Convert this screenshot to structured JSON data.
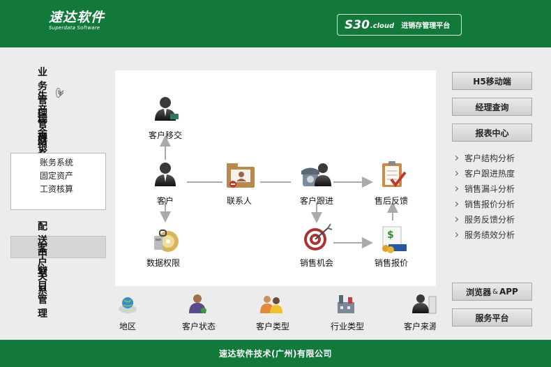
{
  "header": {
    "logo_main": "速达软件",
    "logo_sub": "Superdata Software",
    "brand_s30": "S30",
    "brand_cloud": ".cloud",
    "brand_tagline": "进销存管理平台"
  },
  "nav": {
    "items": [
      {
        "label": "业务管理",
        "expandable": true
      },
      {
        "label": "生产管理"
      },
      {
        "label": "现金银行"
      },
      {
        "label": "财务管理",
        "expandable": true
      },
      {
        "label": "配送中心"
      },
      {
        "label": "客户关系",
        "active": true
      },
      {
        "label": "项目管理"
      }
    ],
    "finance_sub": [
      "账务系统",
      "固定资产",
      "工资核算"
    ]
  },
  "flow": {
    "transfer": "客户移交",
    "customer": "客户",
    "contact": "联系人",
    "followup": "客户跟进",
    "feedback": "售后反馈",
    "data_perm": "数据权限",
    "opportunity": "销售机会",
    "quote": "销售报价"
  },
  "bottom": [
    "地区",
    "客户状态",
    "客户类型",
    "行业类型",
    "客户来源"
  ],
  "right": {
    "h5": "H5移动端",
    "manager": "经理查询",
    "report": "报表中心",
    "reports": [
      "客户结构分析",
      "客户跟进热度",
      "销售漏斗分析",
      "销售报价分析",
      "服务反馈分析",
      "服务绩效分析"
    ],
    "browser": "浏览器",
    "amp": "&",
    "app": "APP",
    "service": "服务平台"
  },
  "footer": "速达软件技术(广州)有限公司"
}
